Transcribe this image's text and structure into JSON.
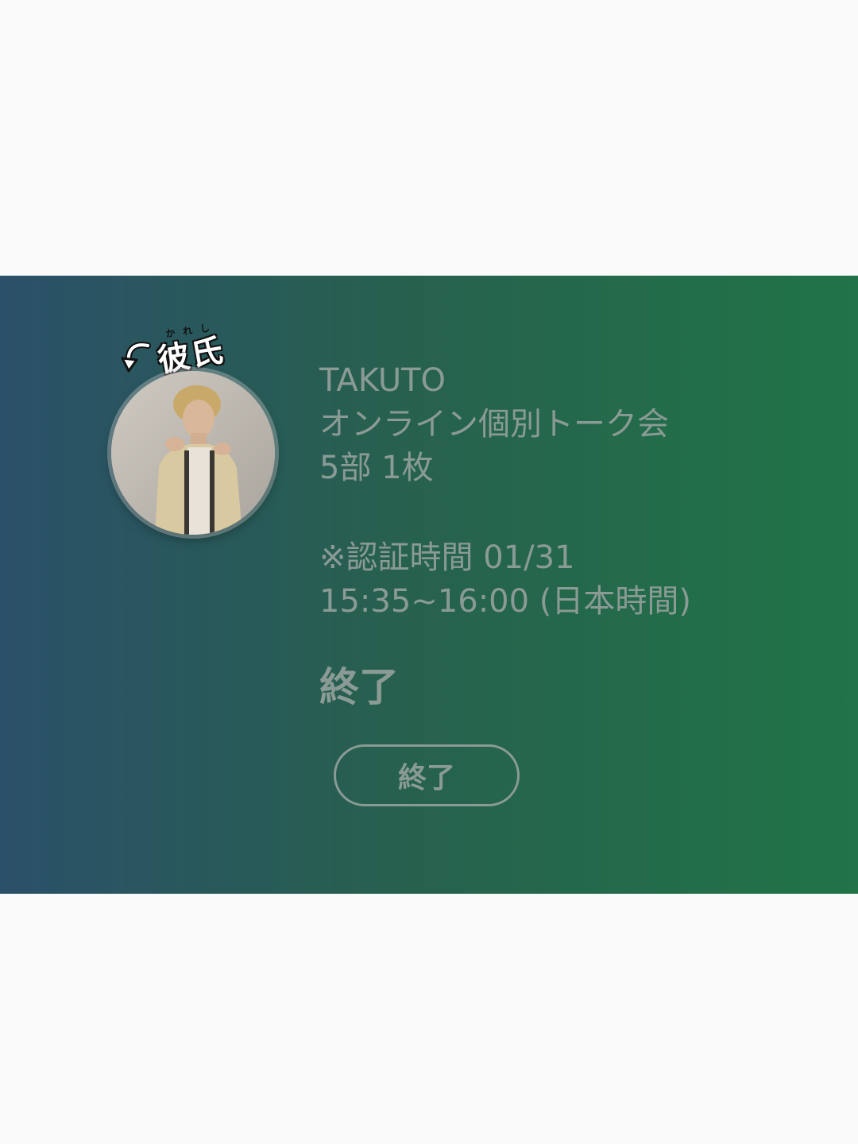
{
  "sticker": {
    "ruby": "かれし",
    "label": "彼氏"
  },
  "ticket": {
    "artist": "TAKUTO",
    "event": "オンライン個別トーク会",
    "session": "5部 1枚",
    "auth_label": "※認証時間 01/31",
    "auth_time": "15:35~16:00 (日本時間)",
    "status": "終了",
    "button_label": "終了"
  },
  "colors": {
    "page_background": "#fafafa",
    "card_gradient_start": "#2b5069",
    "card_gradient_end": "#207447",
    "text_muted": "#8a9a94"
  },
  "icons": {
    "sticker_arrow": "curved-arrow-down-icon",
    "avatar": "profile-photo"
  }
}
